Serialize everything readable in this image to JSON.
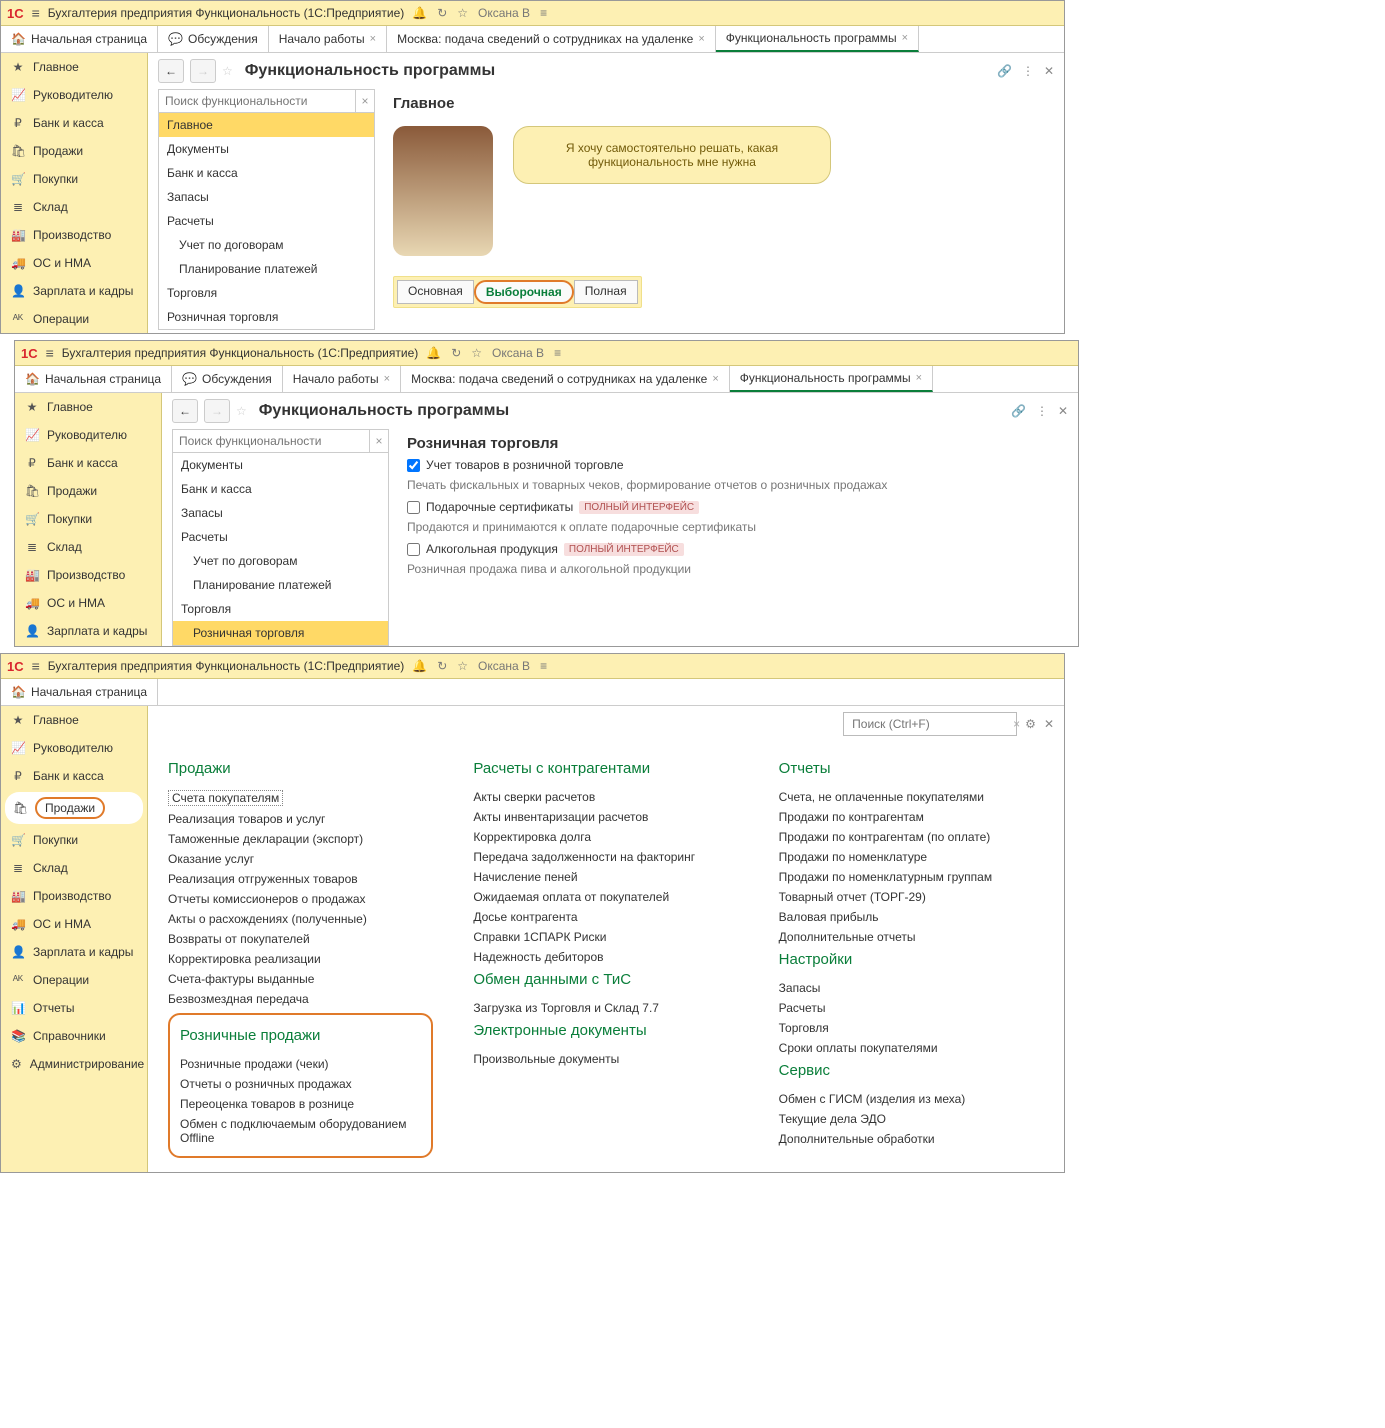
{
  "app_title": "Бухгалтерия предприятия Функциональность  (1С:Предприятие)",
  "user": "Оксана В",
  "tabs": [
    "Начальная страница",
    "Обсуждения",
    "Начало работы",
    "Москва: подача сведений о сотрудниках на удаленке",
    "Функциональность программы"
  ],
  "sidebar": [
    "Главное",
    "Руководителю",
    "Банк и касса",
    "Продажи",
    "Покупки",
    "Склад",
    "Производство",
    "ОС и НМА",
    "Зарплата и кадры",
    "Операции",
    "Отчеты",
    "Справочники",
    "Администрирование"
  ],
  "sidebar_icons": [
    "★",
    "📈",
    "₽",
    "🛍",
    "🛒",
    "≣",
    "🏭",
    "🚚",
    "👤",
    "ᴬᴷ",
    "📊",
    "📚",
    "⚙"
  ],
  "s1": {
    "title": "Функциональность программы",
    "search_ph": "Поиск функциональности",
    "list": [
      "Главное",
      "Документы",
      "Банк и касса",
      "Запасы",
      "Расчеты",
      "Учет по договорам",
      "Планирование платежей",
      "Торговля",
      "Розничная торговля"
    ],
    "subs": [
      5,
      6
    ],
    "sel": 0,
    "section": "Главное",
    "speech": "Я хочу самостоятельно решать, какая функциональность мне нужна",
    "modes": [
      "Основная",
      "Выборочная",
      "Полная"
    ],
    "mode_sel": 1
  },
  "s2": {
    "title": "Функциональность программы",
    "search_ph": "Поиск функциональности",
    "list": [
      "Документы",
      "Банк и касса",
      "Запасы",
      "Расчеты",
      "Учет по договорам",
      "Планирование платежей",
      "Торговля",
      "Розничная торговля"
    ],
    "subs": [
      4,
      5,
      7
    ],
    "sel": 7,
    "section": "Розничная торговля",
    "chk1": "Учет товаров в розничной торговле",
    "d1": "Печать фискальных и товарных чеков, формирование отчетов о розничных продажах",
    "chk2": "Подарочные сертификаты",
    "d2": "Продаются и принимаются к оплате подарочные сертификаты",
    "chk3": "Алкогольная продукция",
    "d3": "Розничная продажа пива и алкогольной продукции",
    "badge": "ПОЛНЫЙ ИНТЕРФЕЙС"
  },
  "s3": {
    "search_ph": "Поиск (Ctrl+F)",
    "col1": {
      "h": "Продажи",
      "items": [
        "Счета покупателям",
        "Реализация товаров и услуг",
        "Таможенные декларации (экспорт)",
        "Оказание услуг",
        "Реализация отгруженных товаров",
        "Отчеты комиссионеров о продажах",
        "Акты о расхождениях (полученные)",
        "Возвраты от покупателей",
        "Корректировка реализации",
        "Счета-фактуры выданные",
        "Безвозмездная передача"
      ],
      "h2": "Розничные продажи",
      "items2": [
        "Розничные продажи (чеки)",
        "Отчеты о розничных продажах",
        "Переоценка товаров в рознице",
        "Обмен с подключаемым оборудованием Offline"
      ]
    },
    "col2": {
      "h": "Расчеты с контрагентами",
      "items": [
        "Акты сверки расчетов",
        "Акты инвентаризации расчетов",
        "Корректировка долга",
        "Передача задолженности на факторинг",
        "Начисление пеней",
        "Ожидаемая оплата от покупателей",
        "Досье контрагента",
        "Справки 1СПАРК Риски",
        "Надежность дебиторов"
      ],
      "h2": "Обмен данными с ТиС",
      "items2": [
        "Загрузка из Торговля и Склад 7.7"
      ],
      "h3": "Электронные документы",
      "items3": [
        "Произвольные документы"
      ]
    },
    "col3": {
      "h": "Отчеты",
      "items": [
        "Счета, не оплаченные покупателями",
        "Продажи по контрагентам",
        "Продажи по контрагентам (по оплате)",
        "Продажи по номенклатуре",
        "Продажи по номенклатурным группам",
        "Товарный отчет (ТОРГ-29)",
        "Валовая прибыль",
        "Дополнительные отчеты"
      ],
      "h2": "Настройки",
      "items2": [
        "Запасы",
        "Расчеты",
        "Торговля",
        "Сроки оплаты покупателями"
      ],
      "h3": "Сервис",
      "items3": [
        "Обмен с ГИСМ (изделия из меха)",
        "Текущие дела ЭДО",
        "Дополнительные обработки"
      ]
    }
  }
}
